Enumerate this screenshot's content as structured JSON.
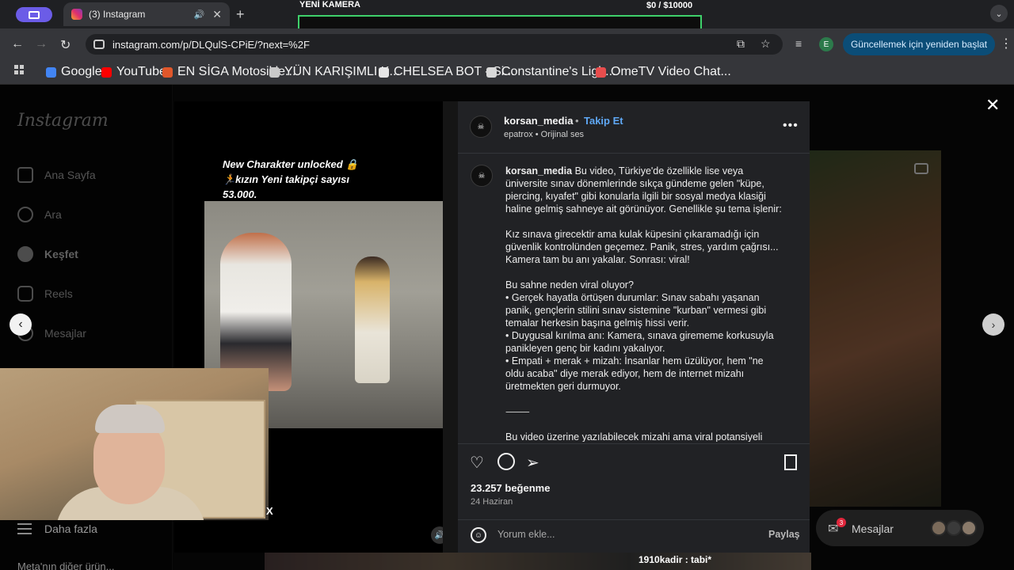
{
  "browser": {
    "tab_title": "(3) Instagram",
    "url": "instagram.com/p/DLQulS-CPiE/?next=%2F",
    "update_button": "Güncellemek için yeniden başlat",
    "profile_letter": "E",
    "bookmarks": [
      {
        "label": "Google",
        "color": "#4285f4"
      },
      {
        "label": "YouTube",
        "color": "#ff0000"
      },
      {
        "label": "EN SİGA Motosikle...",
        "color": "#e0572b"
      },
      {
        "label": "YÜN KARIŞIMLI K...",
        "color": "#c9c9c9"
      },
      {
        "label": "CHELSEA BOT - Si...",
        "color": "#e6e6e6"
      },
      {
        "label": "Constantine's Ligh...",
        "color": "#d9d9d9"
      },
      {
        "label": "OmeTV Video Chat...",
        "color": "#e84d4d"
      }
    ]
  },
  "stream_overlay": {
    "title": "YENİ KAMERA",
    "money": "$0   / $10000",
    "accent": "#3fd16b"
  },
  "sidebar": {
    "logo": "Instagram",
    "items": [
      {
        "label": "Ana Sayfa",
        "icon": "home-icon"
      },
      {
        "label": "Ara",
        "icon": "search-icon"
      },
      {
        "label": "Keşfet",
        "icon": "compass-icon"
      },
      {
        "label": "Reels",
        "icon": "reels-icon"
      },
      {
        "label": "Mesajlar",
        "icon": "messenger-icon"
      }
    ],
    "more": "Daha fazla",
    "meta": "Meta'nın diğer ürün..."
  },
  "video": {
    "caption_line1": "New Charakter unlocked 🔒",
    "caption_line2": "🏃kızın Yeni takipçi sayısı",
    "caption_line3": "53.000."
  },
  "post": {
    "username": "korsan_media",
    "follow": "Takip Et",
    "audio": "epatrox • Orijinal ses",
    "caption_paragraphs": [
      [
        "Bu video, Türkiye'de özellikle lise veya",
        "üniversite sınav dönemlerinde sıkça gündeme gelen \"küpe,",
        "piercing, kıyafet\" gibi konularla ilgili bir sosyal medya klasiği",
        "haline gelmiş sahneye ait görünüyor. Genellikle şu tema işlenir:"
      ],
      [
        "Kız sınava girecektir ama kulak küpesini çıkaramadığı için",
        "güvenlik kontrolünden geçemez. Panik, stres, yardım çağrısı...",
        "Kamera tam bu anı yakalar. Sonrası: viral!"
      ],
      [
        "Bu sahne neden viral oluyor?",
        "• Gerçek hayatla örtüşen durumlar: Sınav sabahı yaşanan",
        "panik, gençlerin stilini sınav sistemine \"kurban\" vermesi gibi",
        "temalar herkesin başına gelmiş hissi verir.",
        "• Duygusal kırılma anı: Kamera, sınava girememe korkusuyla",
        "panikleyen genç bir kadını yakalıyor.",
        "• Empati + merak + mizah: İnsanlar hem üzülüyor, hem \"ne",
        "oldu acaba\" diye merak ediyor, hem de internet mizahı",
        "üretmekten geri durmuyor."
      ],
      [
        "⸻"
      ],
      [
        "Bu video üzerine yazılabilecek mizahi ama viral potansiyeli"
      ]
    ],
    "likes": "23.257 beğenme",
    "date": "24 Haziran",
    "comment_placeholder": "Yorum ekle...",
    "share": "Paylaş"
  },
  "messages": {
    "label": "Mesajlar",
    "badge": "3"
  },
  "chat_overlay": "1910kadir : tabi*",
  "colors": {
    "follow_blue": "#5fa8f5",
    "update_btn": "#0b4d77",
    "badge_red": "#e0263b"
  }
}
